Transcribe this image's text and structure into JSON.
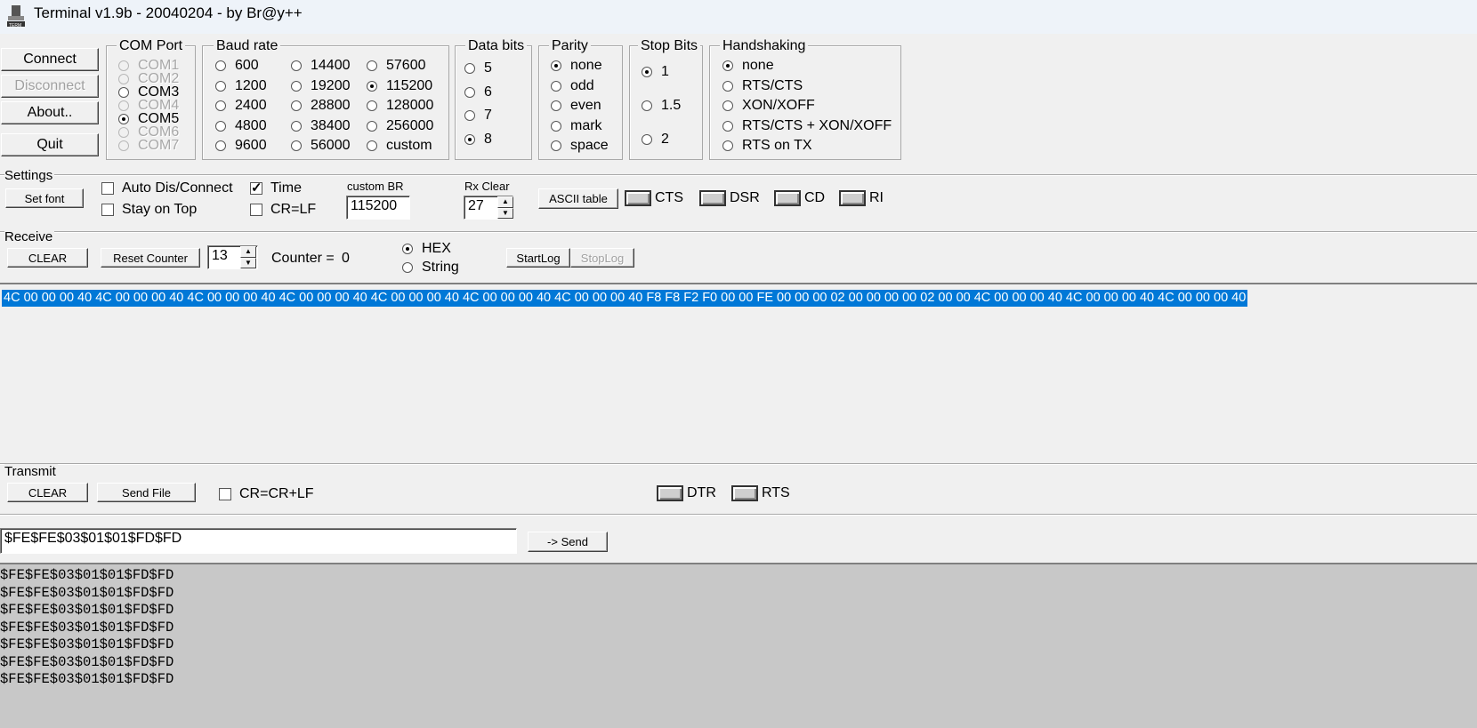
{
  "window": {
    "title": "Terminal v1.9b - 20040204 - by Br@y++",
    "icon": "terminal-app-icon"
  },
  "buttons": {
    "connect": "Connect",
    "disconnect": "Disconnect",
    "about": "About..",
    "quit": "Quit"
  },
  "com_port": {
    "label": "COM Port",
    "items": [
      {
        "label": "COM1",
        "enabled": false,
        "selected": false
      },
      {
        "label": "COM2",
        "enabled": false,
        "selected": false
      },
      {
        "label": "COM3",
        "enabled": true,
        "selected": false
      },
      {
        "label": "COM4",
        "enabled": false,
        "selected": false
      },
      {
        "label": "COM5",
        "enabled": true,
        "selected": true
      },
      {
        "label": "COM6",
        "enabled": false,
        "selected": false
      },
      {
        "label": "COM7",
        "enabled": false,
        "selected": false
      }
    ]
  },
  "baud_rate": {
    "label": "Baud rate",
    "items": [
      "600",
      "1200",
      "2400",
      "4800",
      "9600",
      "14400",
      "19200",
      "28800",
      "38400",
      "56000",
      "57600",
      "115200",
      "128000",
      "256000",
      "custom"
    ],
    "selected": "115200"
  },
  "data_bits": {
    "label": "Data bits",
    "items": [
      "5",
      "6",
      "7",
      "8"
    ],
    "selected": "8"
  },
  "parity": {
    "label": "Parity",
    "items": [
      "none",
      "odd",
      "even",
      "mark",
      "space"
    ],
    "selected": "none"
  },
  "stop_bits": {
    "label": "Stop Bits",
    "items": [
      "1",
      "1.5",
      "2"
    ],
    "selected": "1"
  },
  "handshaking": {
    "label": "Handshaking",
    "items": [
      "none",
      "RTS/CTS",
      "XON/XOFF",
      "RTS/CTS + XON/XOFF",
      "RTS on TX"
    ],
    "selected": "none"
  },
  "settings": {
    "label": "Settings",
    "set_font": "Set font",
    "auto_dis_connect": "Auto Dis/Connect",
    "stay_on_top": "Stay on Top",
    "time": "Time",
    "time_checked": true,
    "crlf": "CR=LF",
    "custom_br_label": "custom BR",
    "custom_br_value": "115200",
    "rx_clear_label": "Rx Clear",
    "rx_clear_value": "27",
    "ascii_table": "ASCII table",
    "leds": [
      "CTS",
      "DSR",
      "CD",
      "RI"
    ]
  },
  "receive": {
    "label": "Receive",
    "clear": "CLEAR",
    "reset_counter": "Reset Counter",
    "counter_spin": "13",
    "counter_label": "Counter =",
    "counter_value": "0",
    "hex": "HEX",
    "string": "String",
    "mode": "HEX",
    "start_log": "StartLog",
    "stop_log": "StopLog",
    "data": "4C 00 00 00 40 4C 00 00 00 40 4C 00 00 00 40 4C 00 00 00 40 4C 00 00 00 40 4C 00 00 00 40 4C 00 00 00 40 F8 F8 F2 F0 00 00 FE 00 00 00 02 00 00 00 00 02 00 00 4C 00 00 00 40 4C 00 00 00 40 4C 00 00 00 40"
  },
  "transmit": {
    "label": "Transmit",
    "clear": "CLEAR",
    "send_file": "Send File",
    "cr_crlf": "CR=CR+LF",
    "leds": [
      "DTR",
      "RTS"
    ],
    "input_value": "$FE$FE$03$01$01$FD$FD",
    "send": "-> Send",
    "log": [
      "$FE$FE$03$01$01$FD$FD",
      "$FE$FE$03$01$01$FD$FD",
      "$FE$FE$03$01$01$FD$FD",
      "$FE$FE$03$01$01$FD$FD",
      "$FE$FE$03$01$01$FD$FD",
      "$FE$FE$03$01$01$FD$FD",
      "$FE$FE$03$01$01$FD$FD"
    ]
  }
}
